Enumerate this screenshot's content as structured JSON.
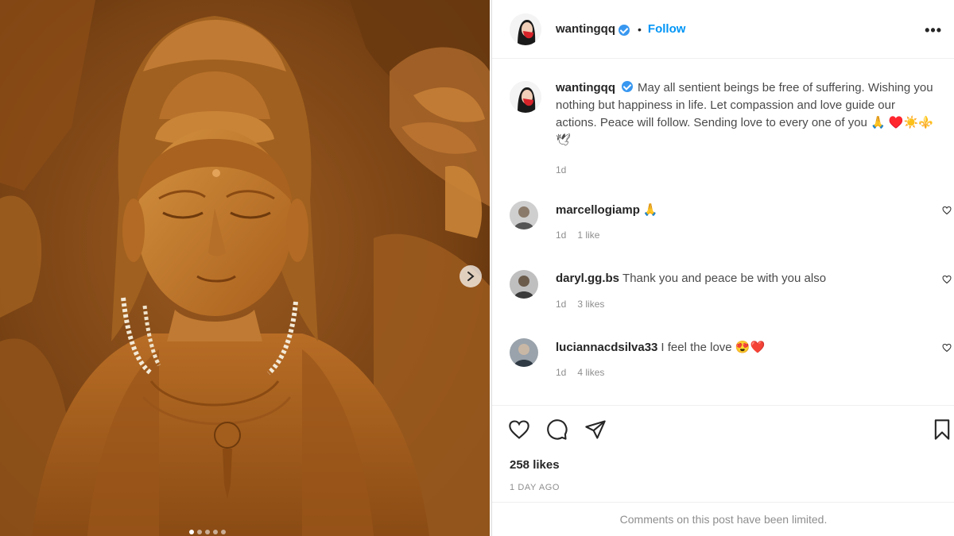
{
  "post": {
    "username": "wantingqq",
    "separator": "•",
    "follow_label": "Follow",
    "more_label": "•••",
    "caption": "May all sentient beings be free of suffering. Wishing you nothing but happiness in life. Let compassion and love guide our actions. Peace will follow. Sending love to every one of you 🙏 ♥️☀️⚜️🕊",
    "caption_time": "1d",
    "likes": "258 likes",
    "posted_ago": "1 DAY AGO",
    "comments_limited": "Comments on this post have been limited."
  },
  "comments": [
    {
      "username": "marcellogiamp",
      "text": "🙏",
      "time": "1d",
      "likes": "1 like"
    },
    {
      "username": "daryl.gg.bs",
      "text": "Thank you and peace be with you also",
      "time": "1d",
      "likes": "3 likes"
    },
    {
      "username": "luciannacdsilva33",
      "text": "I feel the love 😍❤️",
      "time": "1d",
      "likes": "4 likes"
    }
  ],
  "icons": {
    "like": "heart-icon",
    "comment": "comment-icon",
    "share": "share-icon",
    "save": "bookmark-icon",
    "next": "chevron-right-icon"
  },
  "colors": {
    "link": "#0095f6",
    "verified": "#3897f0",
    "statue": "#b0681f"
  },
  "carousel": {
    "slides": 5,
    "active_index": 0
  }
}
